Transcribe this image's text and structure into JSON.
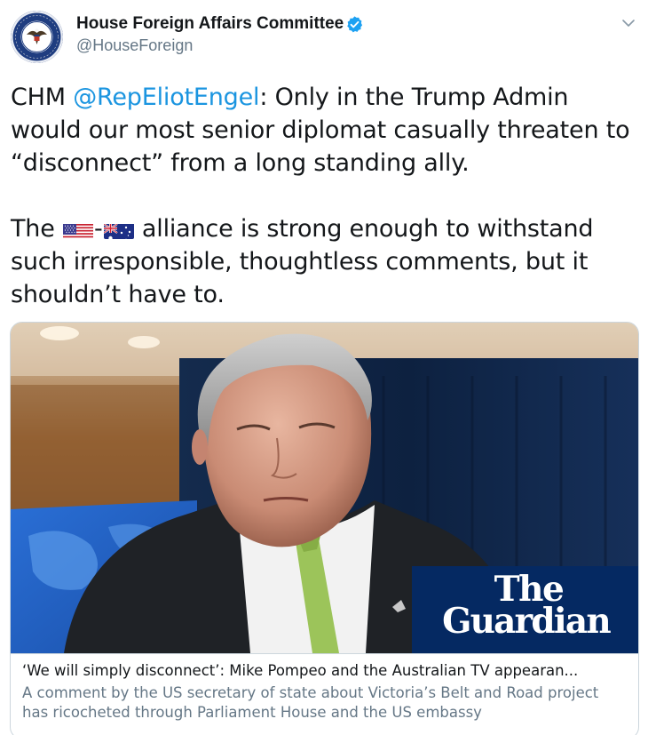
{
  "tweet": {
    "author": {
      "display_name": "House Foreign Affairs Committee",
      "handle": "@HouseForeign",
      "verified": true,
      "avatar_icon": "committee-seal-icon"
    },
    "menu_icon": "chevron-down-icon",
    "text": {
      "p1_prefix": "CHM ",
      "p1_mention": "@RepEliotEngel",
      "p1_suffix": ": Only in the Trump Admin would our most senior diplomat casually threaten to “disconnect” from a long standing ally.",
      "p2_prefix": "The ",
      "p2_dash": "-",
      "p2_suffix": " alliance is strong enough to withstand such irresponsible, thoughtless comments, but it shouldn’t have to."
    },
    "flags": [
      "us-flag-icon",
      "australia-flag-icon"
    ],
    "card": {
      "title": "‘We will simply disconnect’: Mike Pompeo and the Australian TV appearan...",
      "description": "A comment by the US secretary of state about Victoria’s Belt and Road project has ricocheted through Parliament House and the US embassy",
      "publisher_logo_line1": "The",
      "publisher_logo_line2": "Guardian"
    }
  },
  "colors": {
    "link": "#1b95e0",
    "verified": "#1da1f2",
    "guardian_blue": "#052962",
    "secondary_text": "#657786"
  }
}
